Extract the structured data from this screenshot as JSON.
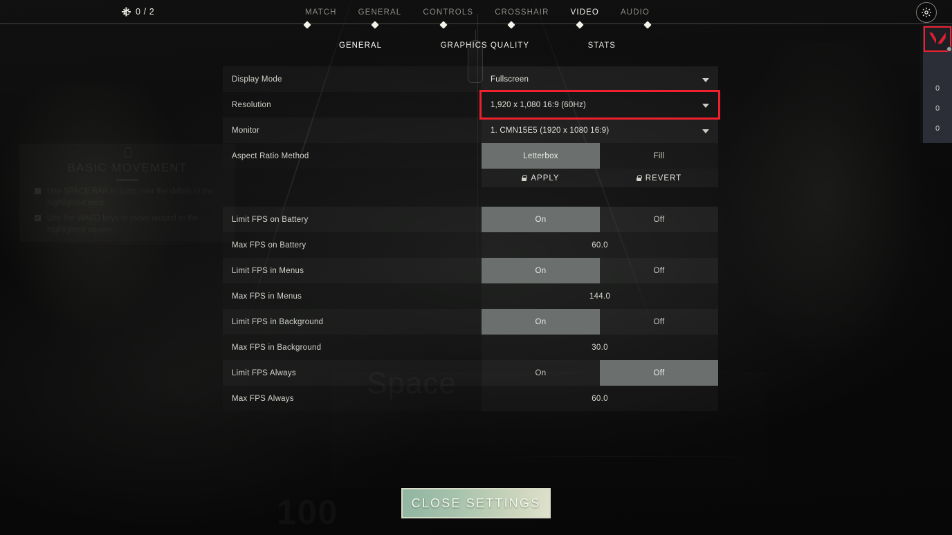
{
  "topbar": {
    "currency": {
      "icon": "spark-icon",
      "value": "0 / 2"
    },
    "settings_icon": "gear-icon",
    "tabs": [
      {
        "label": "MATCH",
        "active": false
      },
      {
        "label": "GENERAL",
        "active": false
      },
      {
        "label": "CONTROLS",
        "active": false
      },
      {
        "label": "CROSSHAIR",
        "active": false
      },
      {
        "label": "VIDEO",
        "active": true
      },
      {
        "label": "AUDIO",
        "active": false
      }
    ]
  },
  "subtabs": [
    {
      "label": "GENERAL",
      "active": true
    },
    {
      "label": "GRAPHICS QUALITY",
      "active": false
    },
    {
      "label": "STATS",
      "active": false
    }
  ],
  "settings": {
    "display_mode": {
      "label": "Display Mode",
      "value": "Fullscreen"
    },
    "resolution": {
      "label": "Resolution",
      "value": "1,920 x 1,080 16:9 (60Hz)",
      "highlight_color": "#f0202c"
    },
    "monitor": {
      "label": "Monitor",
      "value": "1. CMN15E5 (1920 x  1080 16:9)"
    },
    "aspect_ratio": {
      "label": "Aspect Ratio Method",
      "options": [
        "Letterbox",
        "Fill"
      ],
      "selected": "Letterbox"
    },
    "apply": {
      "label": "APPLY",
      "icon": "lock-icon"
    },
    "revert": {
      "label": "REVERT",
      "icon": "lock-icon"
    },
    "limit_fps_battery": {
      "label": "Limit FPS on Battery",
      "options": [
        "On",
        "Off"
      ],
      "selected": "On"
    },
    "max_fps_battery": {
      "label": "Max FPS on Battery",
      "value": "60.0"
    },
    "limit_fps_menus": {
      "label": "Limit FPS in Menus",
      "options": [
        "On",
        "Off"
      ],
      "selected": "On"
    },
    "max_fps_menus": {
      "label": "Max FPS in Menus",
      "value": "144.0"
    },
    "limit_fps_background": {
      "label": "Limit FPS in Background",
      "options": [
        "On",
        "Off"
      ],
      "selected": "On"
    },
    "max_fps_background": {
      "label": "Max FPS in Background",
      "value": "30.0"
    },
    "limit_fps_always": {
      "label": "Limit FPS Always",
      "options": [
        "On",
        "Off"
      ],
      "selected": "Off"
    },
    "max_fps_always": {
      "label": "Max FPS Always",
      "value": "60.0"
    }
  },
  "close_button": {
    "label": "CLOSE SETTINGS",
    "accent": "#a8c3ad"
  },
  "right_rail": {
    "logo_icon": "valorant-logo-icon",
    "border_color": "#ec2030",
    "counts": [
      "0",
      "0",
      "0"
    ]
  },
  "background": {
    "panel_title": "BASIC MOVEMENT",
    "panel_items": [
      "Use SPACE BAR to jump over the debris to the highlighted area.",
      "Use the WASD keys to move around to the highlighted square."
    ],
    "floor_number": "100",
    "floor_text": "Space"
  }
}
